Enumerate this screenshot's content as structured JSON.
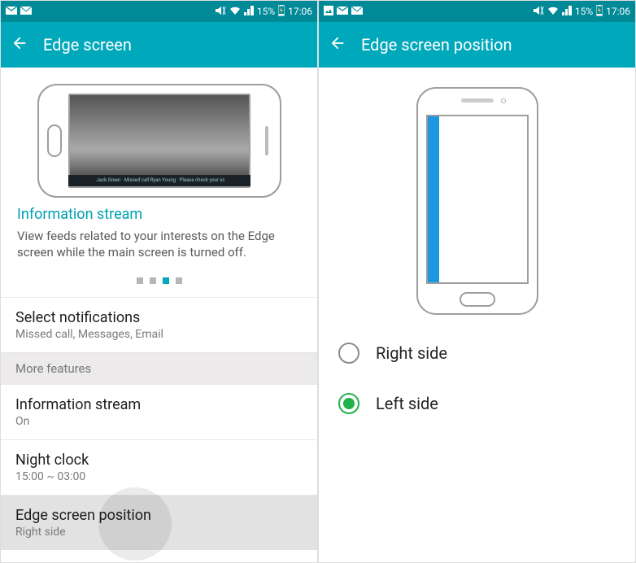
{
  "status": {
    "battery": "15%",
    "time": "17:06"
  },
  "left": {
    "title": "Edge screen",
    "info_title": "Information stream",
    "info_desc": "View feeds related to your interests on the Edge screen while the main screen is turned off.",
    "ticker": "Jack Green · Missed call    Ryan Young · Please check your sc",
    "dots": {
      "count": 4,
      "active_index": 2
    },
    "items": {
      "select_notifications": {
        "title": "Select notifications",
        "subtitle": "Missed call, Messages, Email"
      },
      "subheader": "More features",
      "info_stream": {
        "title": "Information stream",
        "subtitle": "On"
      },
      "night_clock": {
        "title": "Night clock",
        "subtitle": "15:00 ~ 03:00"
      },
      "edge_pos": {
        "title": "Edge screen position",
        "subtitle": "Right side"
      }
    }
  },
  "right": {
    "title": "Edge screen position",
    "options": {
      "right": "Right side",
      "left": "Left side"
    },
    "selected": "left"
  }
}
